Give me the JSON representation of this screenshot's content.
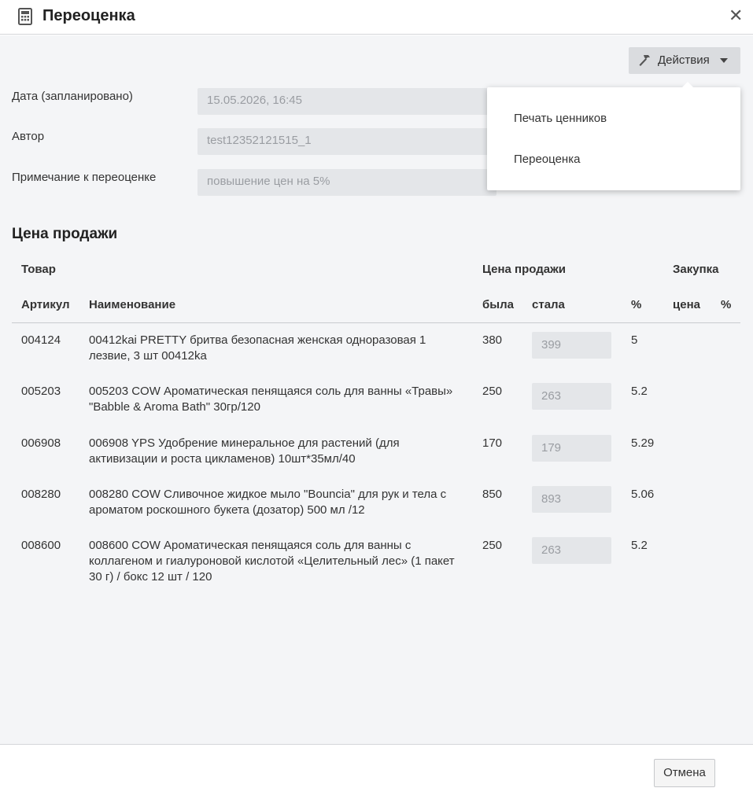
{
  "dialog": {
    "title": "Переоценка",
    "actions_label": "Действия",
    "dropdown_items": [
      "Печать ценников",
      "Переоценка"
    ],
    "cancel_label": "Отмена"
  },
  "fields": [
    {
      "label": "Дата (запланировано)",
      "value": "15.05.2026, 16:45"
    },
    {
      "label": "Автор",
      "value": "test12352121515_1"
    },
    {
      "label": "Примечание к переоценке",
      "value": "повышение цен на 5%"
    }
  ],
  "section_title": "Цена продажи",
  "table": {
    "group_headers": {
      "product": "Товар",
      "sale_price": "Цена продажи",
      "purchase": "Закупка"
    },
    "headers": {
      "article": "Артикул",
      "name": "Наименование",
      "was": "была",
      "became": "стала",
      "percent": "%",
      "purchase_price": "цена",
      "purchase_percent": "%"
    },
    "rows": [
      {
        "article": "004124",
        "name": "00412kai PRETTY бритва безопасная женская одноразовая 1 лезвие, 3 шт 00412ka",
        "was": "380",
        "became": "399",
        "percent": "5"
      },
      {
        "article": "005203",
        "name": "005203 COW Ароматическая пенящаяся соль для ванны «Травы» \"Babble & Aroma Bath\" 30гр/120",
        "was": "250",
        "became": "263",
        "percent": "5.2"
      },
      {
        "article": "006908",
        "name": "006908 YPS Удобрение минеральное для растений (для активизации и роста цикламенов) 10шт*35мл/40",
        "was": "170",
        "became": "179",
        "percent": "5.29"
      },
      {
        "article": "008280",
        "name": "008280 COW Сливочное жидкое мыло \"Bouncia\" для рук и тела с ароматом роскошного букета (дозатор) 500 мл /12",
        "was": "850",
        "became": "893",
        "percent": "5.06"
      },
      {
        "article": "008600",
        "name": "008600 COW Ароматическая пенящаяся соль для ванны с коллагеном и гиалуроновой кислотой «Целительный лес» (1 пакет 30 г) / бокс 12 шт / 120",
        "was": "250",
        "became": "263",
        "percent": "5.2"
      }
    ]
  },
  "icons": {
    "title": "calculator-icon",
    "close": "close-icon",
    "actions": "hammer-icon",
    "caret": "caret-down-icon"
  }
}
